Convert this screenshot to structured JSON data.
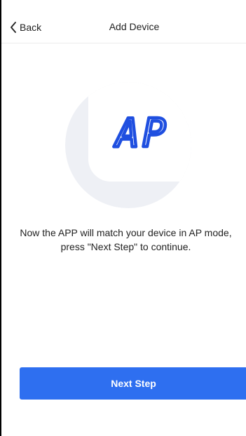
{
  "navbar": {
    "back_label": "Back",
    "title": "Add Device"
  },
  "illustration": {
    "display_text": "AP",
    "circle_color": "#eef0f5",
    "text_color": "#1f4fe0"
  },
  "instruction": {
    "text": "Now the APP will match your device in AP mode, press \"Next Step\" to continue."
  },
  "actions": {
    "next_label": "Next Step",
    "button_color": "#2e6ff0"
  }
}
